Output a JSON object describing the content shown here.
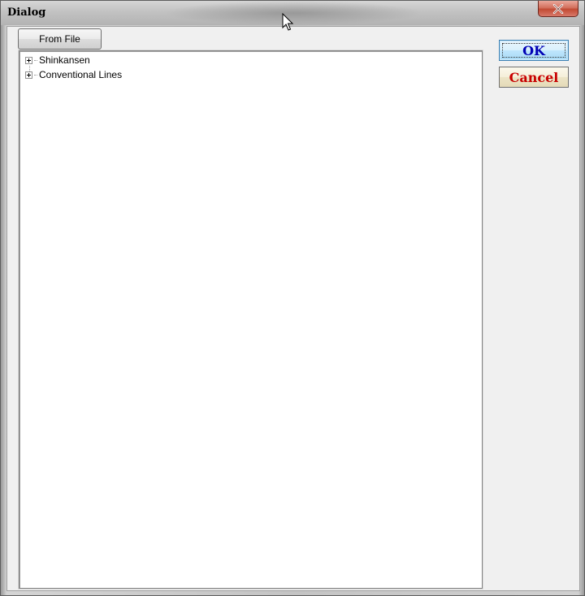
{
  "window": {
    "title": "Dialog"
  },
  "toolbar": {
    "from_file_label": "From File"
  },
  "tree": {
    "items": [
      {
        "label": "Shinkansen",
        "expanded": false
      },
      {
        "label": "Conventional Lines",
        "expanded": false
      }
    ]
  },
  "buttons": {
    "ok_label": "OK",
    "cancel_label": "Cancel",
    "ok_color": "#0000b4",
    "cancel_color": "#c80000"
  },
  "icons": {
    "close": "close-icon",
    "expand": "plus-expand-icon",
    "cursor": "mouse-pointer-icon"
  }
}
